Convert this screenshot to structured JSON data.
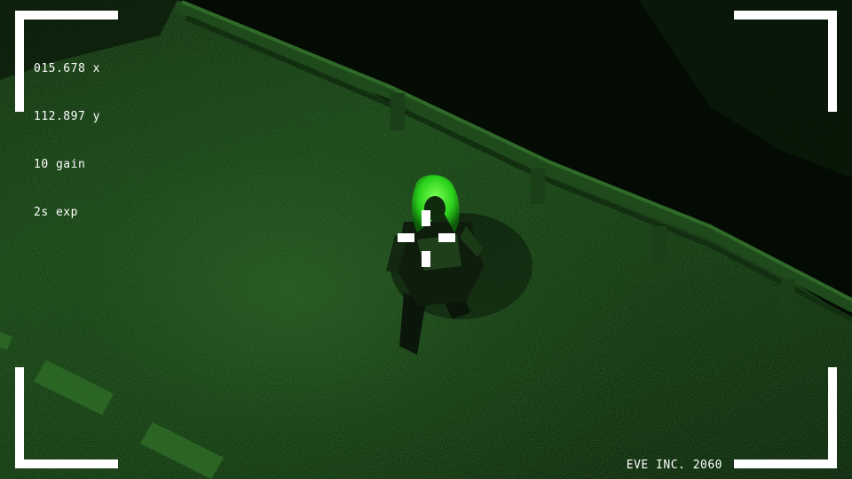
{
  "hud": {
    "readout": {
      "x_line": "015.678 x",
      "y_line": "112.897 y",
      "gain_line": "10 gain",
      "exposure_line": "2s exp"
    },
    "brand": "EVE INC. 2060"
  },
  "colors": {
    "hud": "#ffffff",
    "night_vision_bright": "#3cff2a",
    "night_vision_dark": "#0e280d"
  },
  "icons": {
    "reticle": "crosshair-icon",
    "frame": "viewfinder-corner-icon"
  }
}
